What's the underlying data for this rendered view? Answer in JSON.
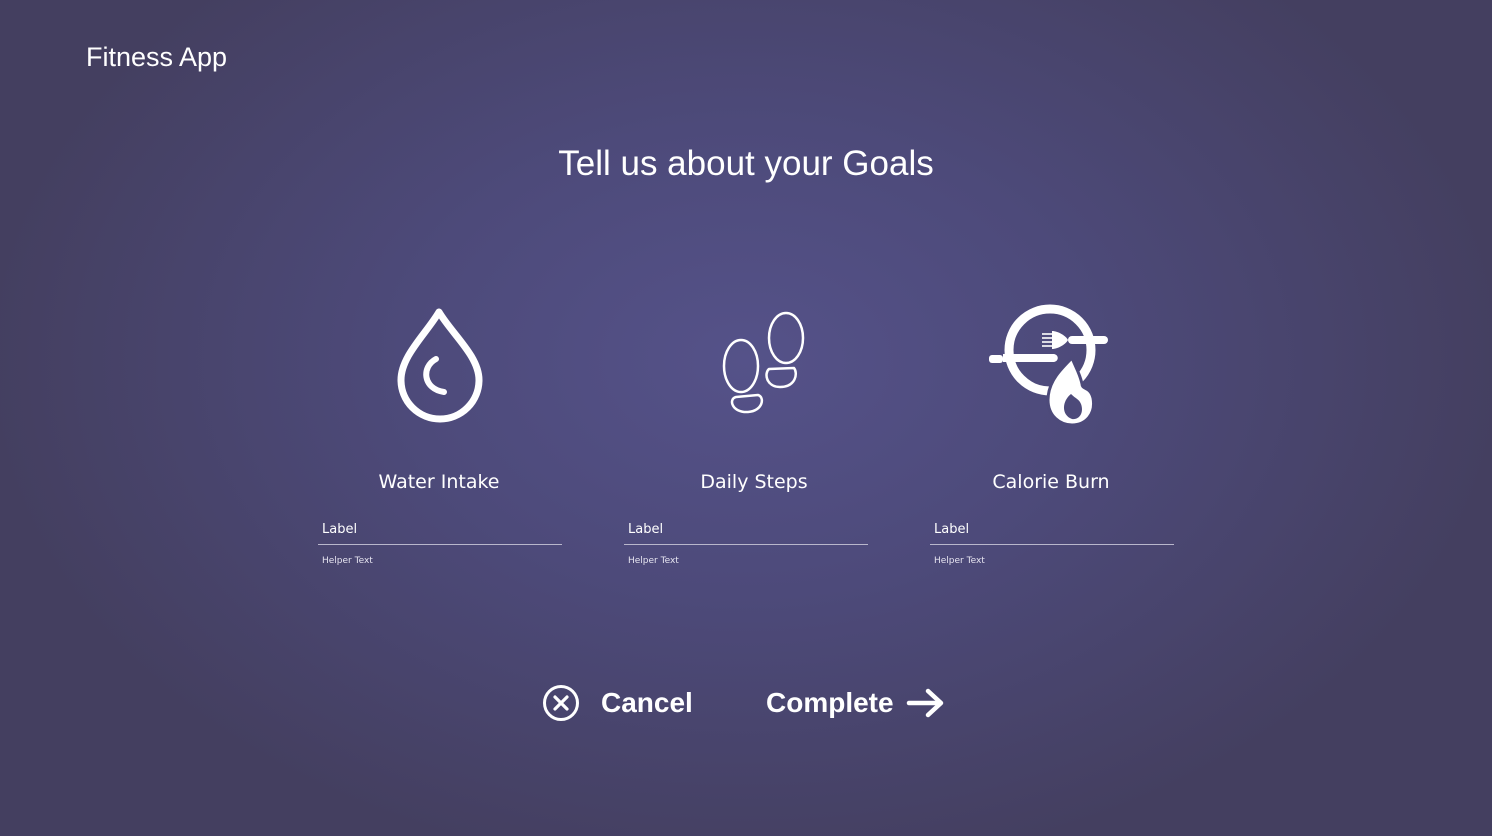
{
  "app": {
    "title": "Fitness App"
  },
  "page": {
    "heading": "Tell us about your Goals"
  },
  "goals": [
    {
      "name": "Water Intake",
      "icon": "water-drop-icon",
      "input_placeholder": "Label",
      "helper": "Helper Text"
    },
    {
      "name": "Daily Steps",
      "icon": "footsteps-icon",
      "input_placeholder": "Label",
      "helper": "Helper Text"
    },
    {
      "name": "Calorie Burn",
      "icon": "calorie-burn-icon",
      "input_placeholder": "Label",
      "helper": "Helper Text"
    }
  ],
  "actions": {
    "cancel_label": "Cancel",
    "cancel_icon": "close-circle-icon",
    "complete_label": "Complete",
    "complete_icon": "arrow-right-icon"
  },
  "colors": {
    "background_center": "#555289",
    "background_edge": "#443f60",
    "text": "#ffffff",
    "input_underline": "#b9b7cc"
  }
}
